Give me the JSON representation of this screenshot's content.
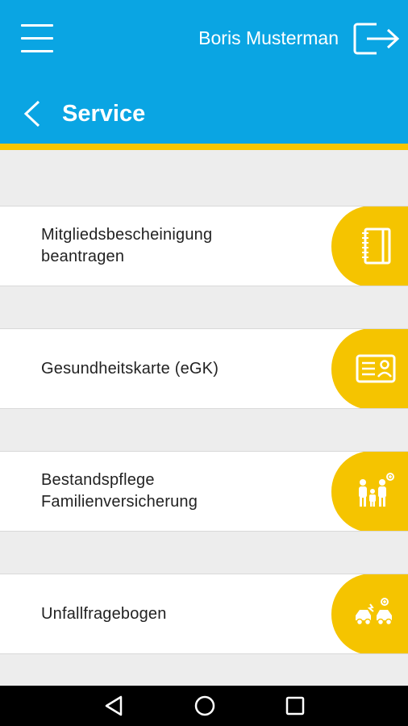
{
  "header": {
    "user_name": "Boris Musterman",
    "title": "Service",
    "icons": {
      "menu": "hamburger-menu-icon",
      "logout": "logout-icon",
      "back": "back-chevron-icon"
    }
  },
  "services": [
    {
      "label": "Mitgliedsbescheinigung\nbeantragen",
      "icon": "notebook-icon"
    },
    {
      "label": "Gesundheitskarte (eGK)",
      "icon": "id-card-icon"
    },
    {
      "label": "Bestandspflege\nFamilienversicherung",
      "icon": "family-icon"
    },
    {
      "label": "Unfallfragebogen",
      "icon": "car-accident-icon"
    }
  ],
  "system_nav": {
    "icons": [
      "nav-back-icon",
      "nav-home-icon",
      "nav-recents-icon"
    ]
  },
  "colors": {
    "primary": "#0aa5e3",
    "accent": "#f5c400",
    "background": "#ededed",
    "text": "#222222"
  }
}
